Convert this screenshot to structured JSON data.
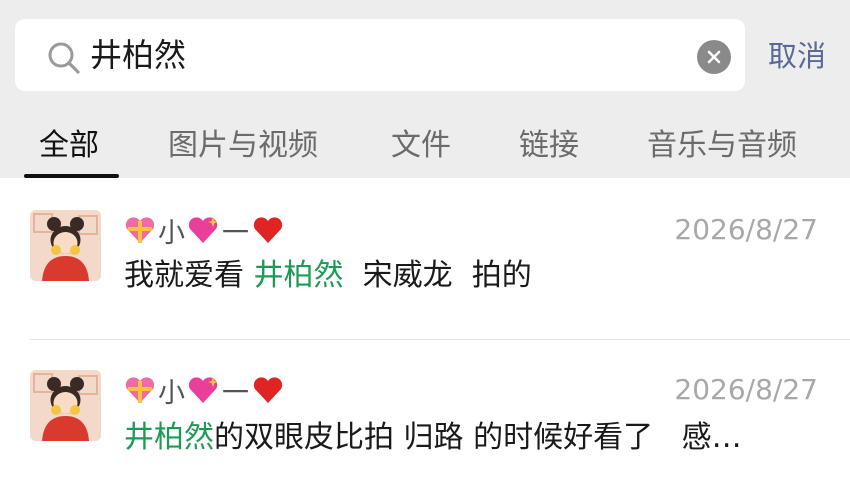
{
  "search": {
    "query": "井柏然",
    "cancel_label": "取消"
  },
  "tabs": [
    {
      "label": "全部",
      "active": true
    },
    {
      "label": "图片与视频",
      "active": false
    },
    {
      "label": "文件",
      "active": false
    },
    {
      "label": "链接",
      "active": false
    },
    {
      "label": "音乐与音频",
      "active": false
    }
  ],
  "results": [
    {
      "name_prefix": "小",
      "name_middle": "一",
      "timestamp": "2026/8/27",
      "snippet_a": "我就爱看 ",
      "snippet_highlight": "井柏然",
      "snippet_b": "  宋威龙  拍的"
    },
    {
      "name_prefix": "小",
      "name_middle": "一",
      "timestamp": "2026/8/27",
      "snippet_highlight": "井柏然",
      "snippet_b": "的双眼皮比拍 归路 的时候好看了   感…"
    }
  ],
  "icons": {
    "search": "search-icon",
    "clear": "clear-icon",
    "gift_heart": "gift-heart-emoji",
    "sparkle_heart": "sparkling-heart-emoji",
    "red_heart": "red-heart-emoji",
    "avatar": "avatar-girl-illustration"
  },
  "colors": {
    "highlight": "#1d9b56",
    "cancel": "#576b95",
    "header_bg": "#ededed"
  }
}
